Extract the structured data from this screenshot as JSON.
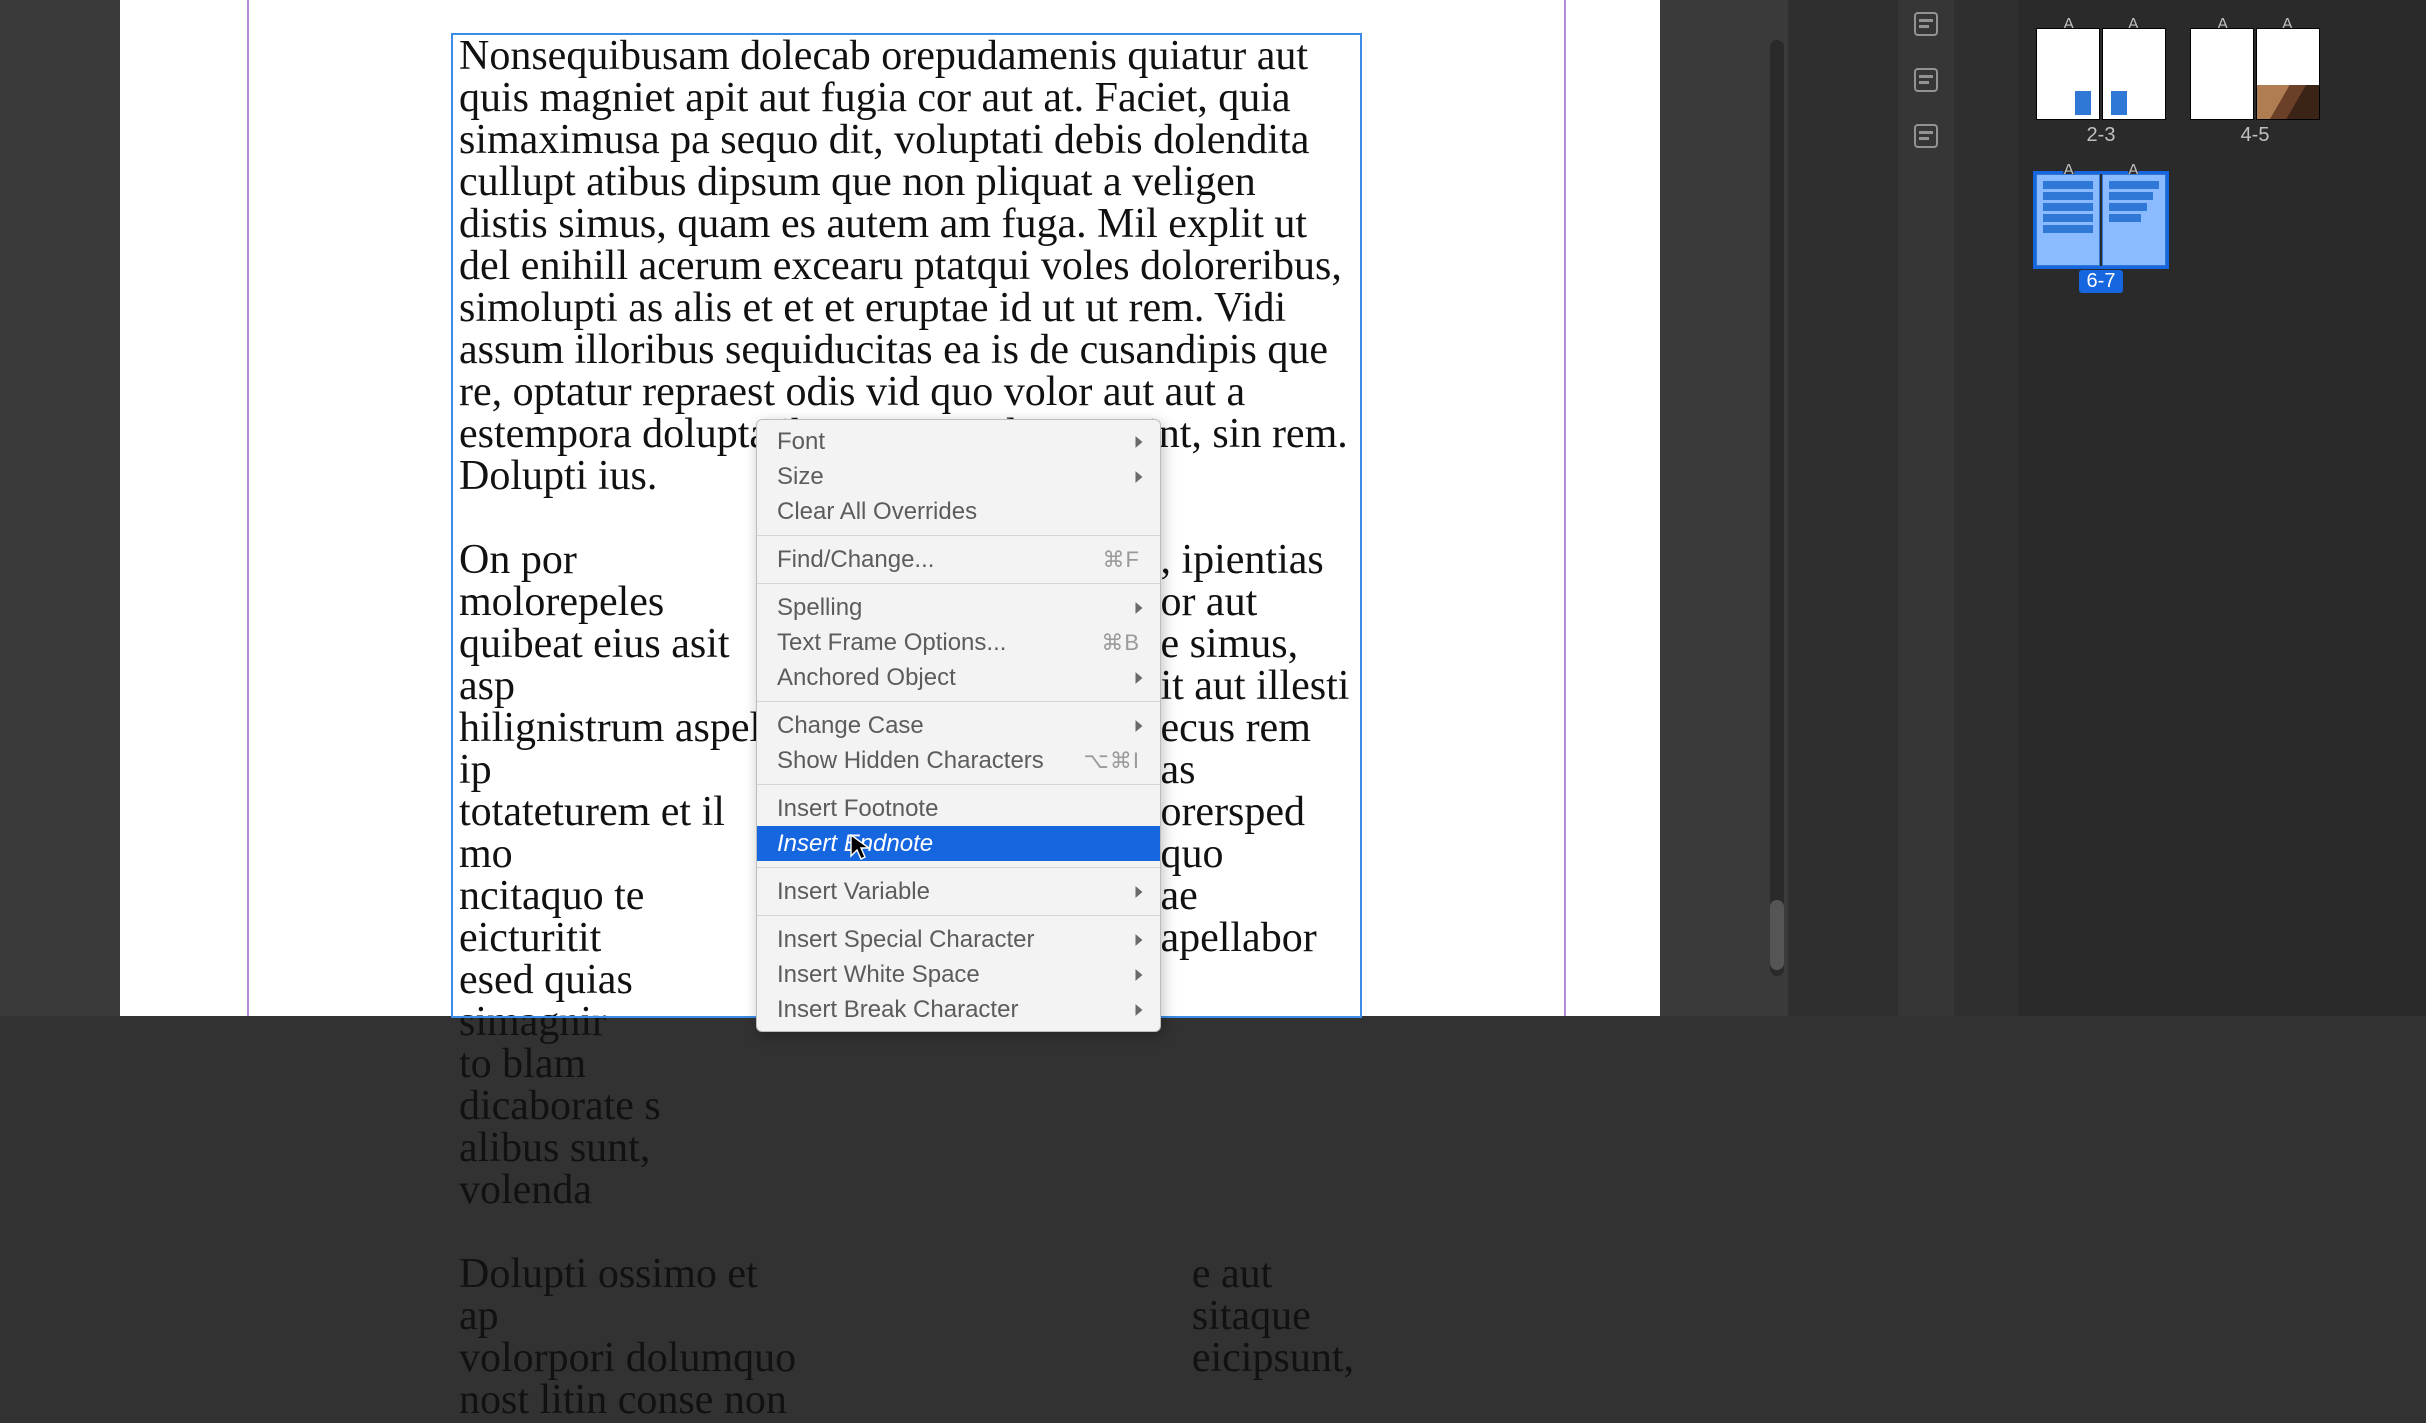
{
  "doc": {
    "para1": "Nonsequibusam dolecab orepudamenis quiatur aut quis magniet apit aut fugia cor aut at. Faciet, quia simaximusa pa sequo dit, voluptati debis dolendita cullupt atibus dipsum que non pliquat a veligen distis simus, quam es autem am fuga. Mil explit ut del enihill acerum excearu ptatqui voles doloreribus, simolupti as alis et et et eruptae id ut ut rem. Vidi assum illoribus sequiducitas ea is de cusandipis que re, optatur repraest odis vid quo volor aut aut a estempora doluptatibus accae volupta estint, sin rem. Dolupti ius.",
    "para2_left": "On por molorepeles\nquibeat eius asit asp\nhilignistrum aspel ip\ntotateturem et il mo\nncitaquo te eicturitit\nesed quias simagnir\nto blam dicaborate s\nalibus sunt, volenda",
    "para2_right": ", ipientias\nor aut\ne simus,\nit aut illesti\necus rem as\norersped quo\nae apellabor",
    "para3_left": "Dolupti ossimo et ap\nvolorpori dolumquo\nnost litin conse non ",
    "para3_right": "e aut\nsitaque\neicipsunt,"
  },
  "menu": {
    "groups": [
      {
        "items": [
          {
            "label": "Font",
            "submenu": true
          },
          {
            "label": "Size",
            "submenu": true
          },
          {
            "label": "Clear All Overrides"
          }
        ]
      },
      {
        "items": [
          {
            "label": "Find/Change...",
            "shortcut": "⌘F"
          }
        ]
      },
      {
        "items": [
          {
            "label": "Spelling",
            "submenu": true
          },
          {
            "label": "Text Frame Options...",
            "shortcut": "⌘B"
          },
          {
            "label": "Anchored Object",
            "submenu": true
          }
        ]
      },
      {
        "items": [
          {
            "label": "Change Case",
            "submenu": true
          },
          {
            "label": "Show Hidden Characters",
            "shortcut": "⌥⌘I"
          }
        ]
      },
      {
        "items": [
          {
            "label": "Insert Footnote"
          },
          {
            "label": "Insert Endnote",
            "highlight": true
          }
        ]
      },
      {
        "items": [
          {
            "label": "Insert Variable",
            "submenu": true
          }
        ]
      },
      {
        "items": [
          {
            "label": "Insert Special Character",
            "submenu": true
          },
          {
            "label": "Insert White Space",
            "submenu": true
          },
          {
            "label": "Insert Break Character",
            "submenu": true
          }
        ]
      }
    ]
  },
  "pages": {
    "spreads": [
      {
        "label": "2-3",
        "current": false,
        "kind": "blue"
      },
      {
        "label": "4-5",
        "current": false,
        "kind": "photo"
      },
      {
        "label": "6-7",
        "current": true,
        "kind": "lines"
      }
    ],
    "master_badge": "A"
  },
  "tools": {
    "icons": [
      "panel-icon",
      "panel-icon",
      "panel-icon"
    ]
  }
}
